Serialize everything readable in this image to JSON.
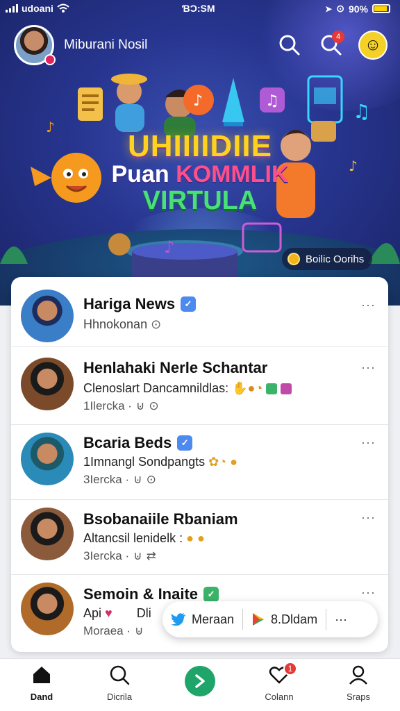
{
  "status_bar": {
    "carrier": "udoani",
    "time": "ƁƆ:SM",
    "battery": "90%"
  },
  "header": {
    "username": "Miburani Nosil"
  },
  "hero": {
    "title_line1": "UHIIIIDIIE",
    "title_line2_a": "Puan ",
    "title_line2_b": "KOMMLIK",
    "title_line3": "VIRTULA",
    "chip_label": "Boilic Oorihs"
  },
  "feed": {
    "items": [
      {
        "name": "Hariga News",
        "line2": "Hhnokonan",
        "line3": "",
        "check_color": "#4c8af0"
      },
      {
        "name": "Henlahaki Nerle Schantar",
        "line2": "Clenoslart Dancamnildlas:",
        "line3": "1Ilercka ·",
        "check_color": ""
      },
      {
        "name": "Bcaria Beds",
        "line2": "1Imnangl Sondpangts",
        "line3": "3Iercka ·",
        "check_color": "#4c8af0"
      },
      {
        "name": "Bsobanaiile Rbaniam",
        "line2": "Altancsil lenidelk :",
        "line3": "3Iercka ·",
        "check_color": ""
      },
      {
        "name": "Semoin & Inaite",
        "line2": "Api",
        "line2_b": "Dli",
        "line3": "Moraea ·",
        "check_color": "#3bb46a"
      }
    ]
  },
  "share_popup": {
    "twitter_label": "Meraan",
    "other_label": "8.Dldam",
    "more": "···"
  },
  "bottom_nav": {
    "items": [
      {
        "label": "Dand"
      },
      {
        "label": "Dicrila"
      },
      {
        "label": ""
      },
      {
        "label": "Colann",
        "badge": "1"
      },
      {
        "label": "Sraps"
      }
    ]
  },
  "icons": {
    "status": [
      "signal-icon",
      "wifi-icon",
      "location-icon",
      "alarm-icon",
      "battery-icon"
    ],
    "header": [
      "search-icon",
      "notification-search-icon",
      "smiley-icon"
    ],
    "nav": [
      "home-icon",
      "search-icon",
      "send-icon",
      "heart-icon",
      "profile-icon"
    ]
  },
  "colors": {
    "accent_green": "#1fa46a",
    "hero_bg": "#27358f",
    "badge_red": "#e53935",
    "verified_blue": "#4c8af0"
  }
}
